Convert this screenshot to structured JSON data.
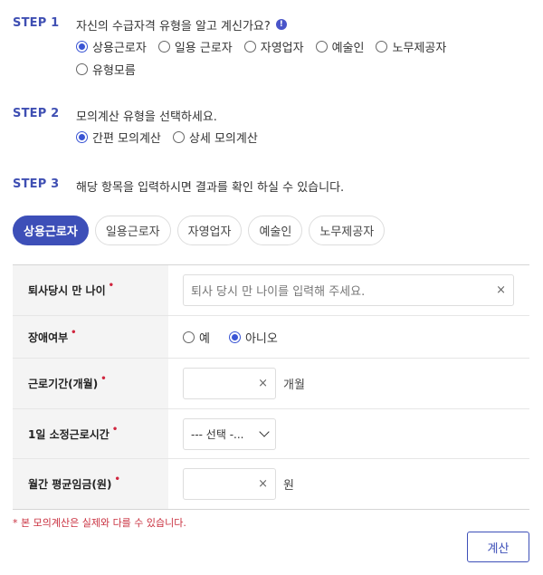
{
  "step1": {
    "label": "STEP 1",
    "question": "자신의 수급자격 유형을 알고 계신가요?",
    "info_icon": "info-circle-icon",
    "options": [
      {
        "label": "상용근로자",
        "selected": true
      },
      {
        "label": "일용 근로자",
        "selected": false
      },
      {
        "label": "자영업자",
        "selected": false
      },
      {
        "label": "예술인",
        "selected": false
      },
      {
        "label": "노무제공자",
        "selected": false
      },
      {
        "label": "유형모름",
        "selected": false
      }
    ]
  },
  "step2": {
    "label": "STEP 2",
    "question": "모의계산 유형을 선택하세요.",
    "options": [
      {
        "label": "간편 모의계산",
        "selected": true
      },
      {
        "label": "상세 모의계산",
        "selected": false
      }
    ]
  },
  "step3": {
    "label": "STEP 3",
    "question": "해당 항목을 입력하시면 결과를 확인 하실 수 있습니다."
  },
  "tabs": [
    {
      "label": "상용근로자",
      "active": true
    },
    {
      "label": "일용근로자",
      "active": false
    },
    {
      "label": "자영업자",
      "active": false
    },
    {
      "label": "예술인",
      "active": false
    },
    {
      "label": "노무제공자",
      "active": false
    }
  ],
  "form": {
    "required_mark": "•",
    "age": {
      "label": "퇴사당시 만 나이",
      "placeholder": "퇴사 당시 만 나이를 입력해 주세요.",
      "clear": "×"
    },
    "disability": {
      "label": "장애여부",
      "options": [
        {
          "label": "예",
          "selected": false
        },
        {
          "label": "아니오",
          "selected": true
        }
      ]
    },
    "work_period": {
      "label": "근로기간(개월)",
      "value": "",
      "clear": "×",
      "unit": "개월"
    },
    "daily_hours": {
      "label": "1일 소정근로시간",
      "selected": "--- 선택 -..."
    },
    "monthly_wage": {
      "label": "월간 평균임금(원)",
      "value": "",
      "clear": "×",
      "unit": "원"
    }
  },
  "note": "* 본 모의계산은 실제와 다를 수 있습니다.",
  "calc_button": "계산",
  "colors": {
    "accent": "#3d4fb8",
    "required": "#d0263f"
  }
}
